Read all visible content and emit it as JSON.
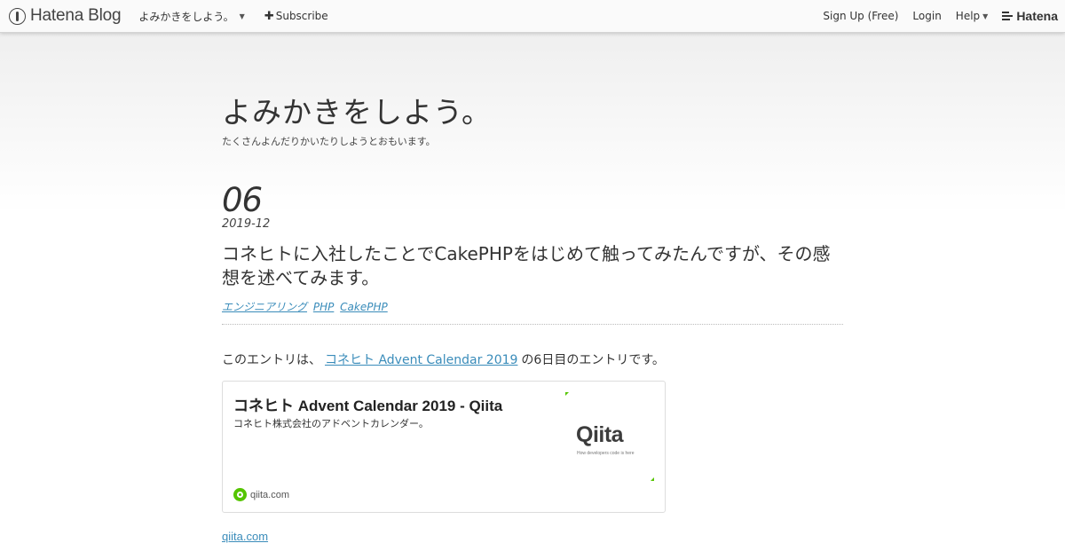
{
  "topbar": {
    "brand_name": "Hatena Blog",
    "blog_menu_label": "よみかきをしよう。",
    "subscribe_label": "Subscribe",
    "signup_label": "Sign Up (Free)",
    "login_label": "Login",
    "help_label": "Help",
    "hatena_label": "Hatena"
  },
  "blog": {
    "title": "よみかきをしよう。",
    "description": "たくさんよんだりかいたりしようとおもいます。"
  },
  "entry": {
    "date_day": "06",
    "date_year_month": "2019-12",
    "title": "コネヒトに入社したことでCakePHPをはじめて触ってみたんですが、その感想を述べてみます。",
    "categories": [
      "エンジニアリング",
      "PHP",
      "CakePHP"
    ],
    "intro_before": "このエントリは、",
    "intro_link": "コネヒト Advent Calendar 2019",
    "intro_after": "の6日目のエントリです。",
    "embed": {
      "title": "コネヒト Advent Calendar 2019 - Qiita",
      "description": "コネヒト株式会社のアドベントカレンダー。",
      "thumb_logo": "Qiita",
      "thumb_tagline": "How developers code is here",
      "domain": "qiita.com"
    },
    "source_link": "qiita.com"
  },
  "colors": {
    "link": "#3a8cba",
    "qiita_green": "#55c500"
  },
  "icons": [
    "hatena-blog-logo-icon",
    "caret-down-icon",
    "plus-icon",
    "hatena-logo-icon",
    "qiita-favicon-icon"
  ]
}
